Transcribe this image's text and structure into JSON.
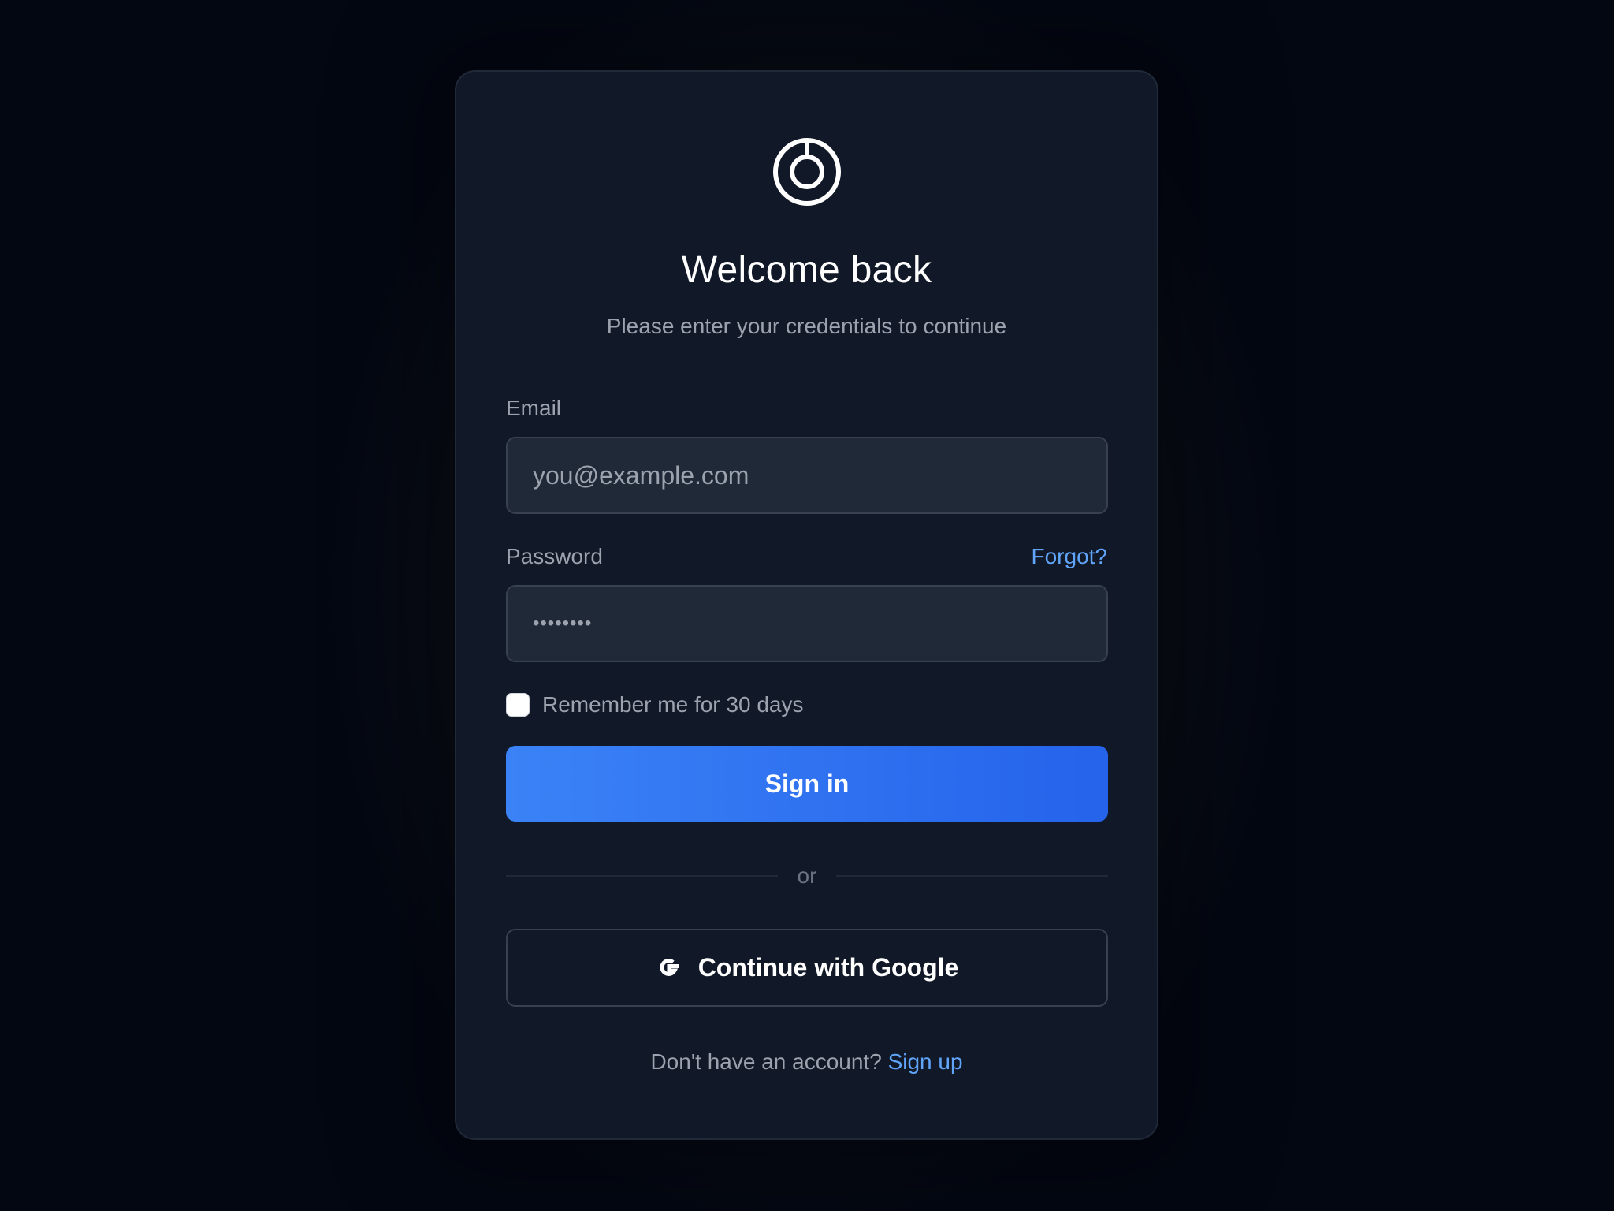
{
  "header": {
    "logo_icon": "power-ring-icon",
    "title": "Welcome back",
    "subtitle": "Please enter your credentials to continue"
  },
  "form": {
    "email_label": "Email",
    "email_placeholder": "you@example.com",
    "email_value": "",
    "password_label": "Password",
    "password_value": "••••••••",
    "forgot_link": "Forgot?",
    "remember_label": "Remember me for 30 days",
    "remember_checked": false,
    "signin_label": "Sign in"
  },
  "divider": {
    "text": "or"
  },
  "social": {
    "google_icon": "google-icon",
    "google_label": "Continue with Google"
  },
  "footer": {
    "prompt": "Don't have an account?",
    "signup_link": "Sign up"
  },
  "colors": {
    "accent": "#3b82f6",
    "accent_dark": "#2563eb",
    "link": "#60a5fa",
    "card_bg": "#111827",
    "field_bg": "#1f2937"
  }
}
